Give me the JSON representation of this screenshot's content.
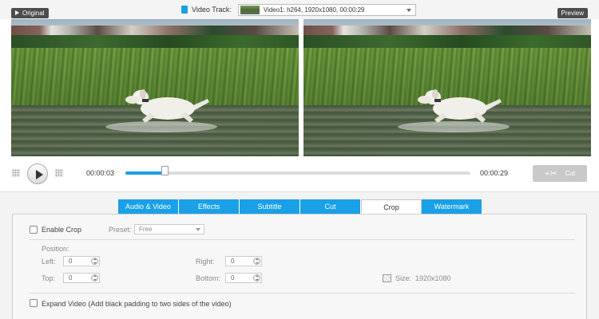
{
  "top": {
    "original_label": "Original",
    "preview_label": "Preview",
    "video_track_label": "Video Track:",
    "video_track_value": "Video1: h264, 1920x1080, 00:00:29"
  },
  "playback": {
    "current_time": "00:00:03",
    "total_time": "00:00:29",
    "progress": 0.115,
    "cut_label": "Cut"
  },
  "tabs": [
    {
      "label": "Audio & Video",
      "active": false
    },
    {
      "label": "Effects",
      "active": false
    },
    {
      "label": "Subtitle",
      "active": false
    },
    {
      "label": "Cut",
      "active": false
    },
    {
      "label": "Crop",
      "active": true
    },
    {
      "label": "Watermark",
      "active": false
    }
  ],
  "crop": {
    "enable_label": "Enable Crop",
    "enable_checked": false,
    "preset_label": "Preset:",
    "preset_value": "Free",
    "position_label": "Position:",
    "left_label": "Left:",
    "left_value": "0",
    "right_label": "Right:",
    "right_value": "0",
    "top_label": "Top:",
    "top_value": "0",
    "bottom_label": "Bottom:",
    "bottom_value": "0",
    "size_label": "Size:",
    "size_value": "1920x1080",
    "expand_label": "Expand Video (Add black padding to two sides of the video)",
    "expand_checked": false
  },
  "icons": {
    "play": "play-icon",
    "scissors": "scissors-icon",
    "video_track": "film-icon",
    "size": "size-icon"
  },
  "colors": {
    "accent": "#19a0e6",
    "label_bg": "#4d4d4d",
    "cut_disabled": "#c9c9c9"
  }
}
